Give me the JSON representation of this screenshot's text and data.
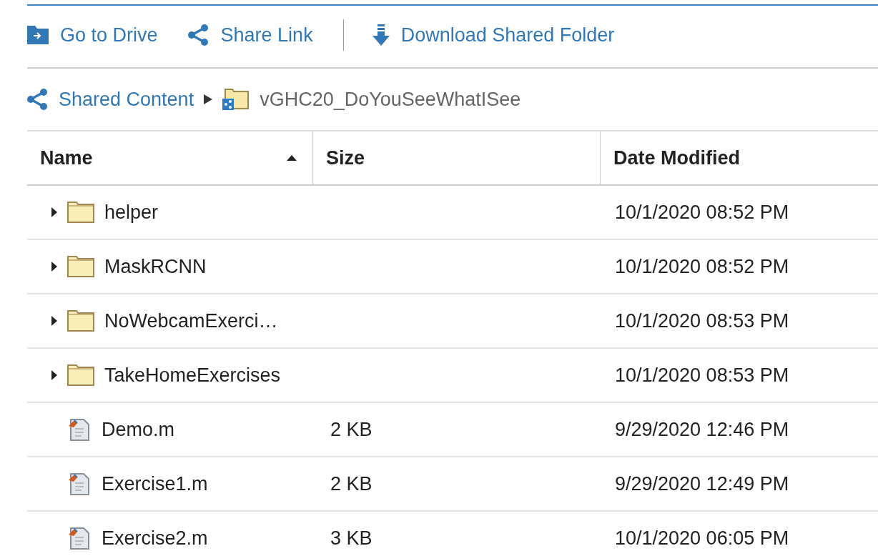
{
  "toolbar": [
    {
      "label": "Go to Drive",
      "kind": "drive"
    },
    {
      "label": "Share Link",
      "kind": "share"
    },
    {
      "label": "Download Shared Folder",
      "kind": "download"
    }
  ],
  "breadcrumb": {
    "root": "Shared Content",
    "folder": "vGHC20_DoYouSeeWhatISee"
  },
  "table": {
    "columns": [
      {
        "label": "Name",
        "sorted": true
      },
      {
        "label": "Size",
        "sorted": false
      },
      {
        "label": "Date Modified",
        "sorted": false
      }
    ],
    "rows": [
      {
        "kind": "folder",
        "name": "helper",
        "date": "10/1/2020 08:52 PM"
      },
      {
        "kind": "folder",
        "name": "MaskRCNN",
        "date": "10/1/2020 08:52 PM"
      },
      {
        "kind": "folder",
        "name": "NoWebcamExerci…",
        "date": "10/1/2020 08:53 PM"
      },
      {
        "kind": "folder",
        "name": "TakeHomeExercises",
        "date": "10/1/2020 08:53 PM"
      },
      {
        "kind": "file",
        "name": "Demo.m",
        "size": "2 KB",
        "date": "9/29/2020 12:46 PM"
      },
      {
        "kind": "file",
        "name": "Exercise1.m",
        "size": "2 KB",
        "date": "9/29/2020 12:49 PM"
      },
      {
        "kind": "file",
        "name": "Exercise2.m",
        "size": "3 KB",
        "date": "10/1/2020 06:05 PM"
      }
    ]
  }
}
